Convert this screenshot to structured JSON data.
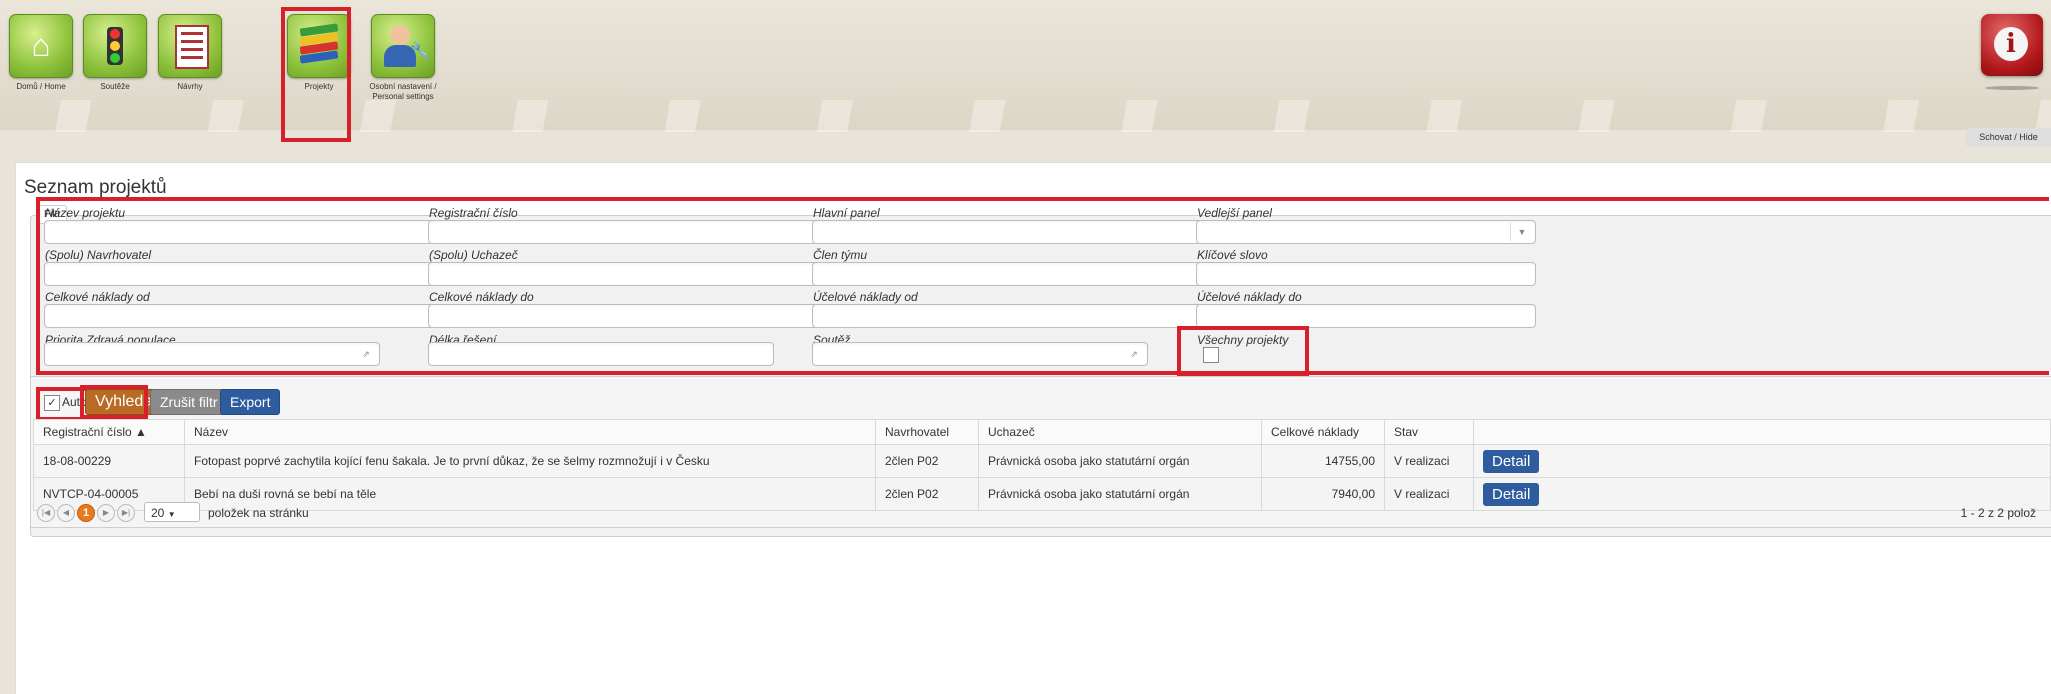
{
  "nav": {
    "items": [
      {
        "label": "Domů / Home",
        "icon": "home-icon"
      },
      {
        "label": "Soutěže",
        "icon": "traffic-light-icon"
      },
      {
        "label": "Návrhy",
        "icon": "document-icon"
      },
      {
        "label": "Projekty",
        "icon": "books-icon"
      },
      {
        "label": "Osobní nastavení / Personal settings",
        "icon": "user-settings-icon"
      }
    ],
    "info_icon": "info-icon",
    "hide_label": "Schovat / Hide"
  },
  "page": {
    "title": "Seznam projektů"
  },
  "filter": {
    "legend": "Filtr",
    "fields": {
      "nazev_projektu": "Název projektu",
      "registracni_cislo": "Registrační číslo",
      "hlavni_panel": "Hlavní panel",
      "vedlejsi_panel": "Vedlejší panel",
      "navrhovatel": "(Spolu) Navrhovatel",
      "uchazec": "(Spolu) Uchazeč",
      "clen_tymu": "Člen týmu",
      "klicove_slovo": "Klíčové slovo",
      "celk_od": "Celkové náklady od",
      "celk_do": "Celkové náklady do",
      "ucel_od": "Účelové náklady od",
      "ucel_do": "Účelové náklady do",
      "priorita": "Priorita Zdravá populace",
      "delka": "Délka řešení",
      "soutez": "Soutěž",
      "vsechny": "Všechny projekty"
    }
  },
  "toolbar": {
    "auto_label": "Auto",
    "search_label": "Vyhledat",
    "clear_label": "Zrušit filtr",
    "export_label": "Export"
  },
  "table": {
    "headers": [
      "Registrační číslo ▲",
      "Název",
      "Navrhovatel",
      "Uchazeč",
      "Celkové náklady",
      "Stav",
      ""
    ],
    "rows": [
      {
        "reg": "18-08-00229",
        "nazev": "Fotopast poprvé zachytila kojící fenu šakala. Je to první důkaz, že se šelmy rozmnožují i v Česku",
        "navrh": "2člen P02",
        "uchazec": "Právnická osoba jako statutární orgán",
        "naklady": "14755,00",
        "stav": "V realizaci",
        "action": "Detail"
      },
      {
        "reg": "NVTCP-04-00005",
        "nazev": "Bebí na duši rovná se bebí na těle",
        "navrh": "2člen P02",
        "uchazec": "Právnická osoba jako statutární orgán",
        "naklady": "7940,00",
        "stav": "V realizaci",
        "action": "Detail"
      }
    ]
  },
  "pager": {
    "current_page": "1",
    "page_size": "20",
    "page_size_label": "položek na stránku",
    "info": "1 - 2 z 2 polož"
  }
}
